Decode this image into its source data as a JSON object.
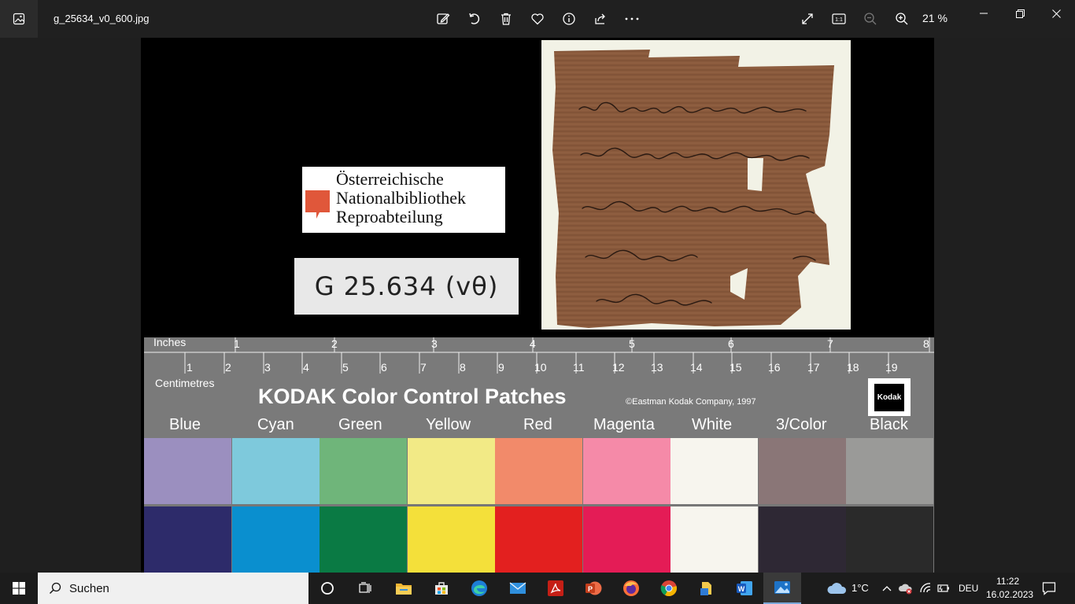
{
  "window": {
    "filename": "g_25634_v0_600.jpg",
    "zoom": "21 %",
    "fit_label": "1:1"
  },
  "image": {
    "logo_text": [
      "Österreichische",
      "Nationalbibliothek",
      "Reproabteilung"
    ],
    "shelfmark": "G 25.634 (vθ)",
    "ruler": {
      "inches_label": "Inches",
      "centimetres_label": "Centimetres",
      "inch_marks": [
        "1",
        "2",
        "3",
        "4",
        "5",
        "6",
        "7",
        "8"
      ],
      "cm_marks": [
        "1",
        "2",
        "3",
        "4",
        "5",
        "6",
        "7",
        "8",
        "9",
        "10",
        "11",
        "12",
        "13",
        "14",
        "15",
        "16",
        "17",
        "18",
        "19"
      ]
    },
    "kodak": {
      "title": "KODAK Color Control Patches",
      "copyright": "©Eastman Kodak Company, 1997",
      "logo_text": "Kodak",
      "patches": [
        {
          "name": "Blue",
          "top": "#9b8fbf",
          "bottom": "#2d2b6a"
        },
        {
          "name": "Cyan",
          "top": "#7ec9dc",
          "bottom": "#0a8fcf"
        },
        {
          "name": "Green",
          "top": "#6fb57a",
          "bottom": "#0a7a44"
        },
        {
          "name": "Yellow",
          "top": "#f2ea86",
          "bottom": "#f4e03a"
        },
        {
          "name": "Red",
          "top": "#f28a6a",
          "bottom": "#e3201f"
        },
        {
          "name": "Magenta",
          "top": "#f58aa8",
          "bottom": "#e41c56"
        },
        {
          "name": "White",
          "top": "#f7f5ee",
          "bottom": "#f7f5ee"
        },
        {
          "name": "3/Color",
          "top": "#8a7677",
          "bottom": "#2e2834"
        },
        {
          "name": "Black",
          "top": "#9a9a98",
          "bottom": "#2a2a2a"
        }
      ]
    }
  },
  "taskbar": {
    "search_label": "Suchen",
    "temperature": "1°C",
    "language": "DEU",
    "time": "11:22",
    "date": "16.02.2023"
  }
}
